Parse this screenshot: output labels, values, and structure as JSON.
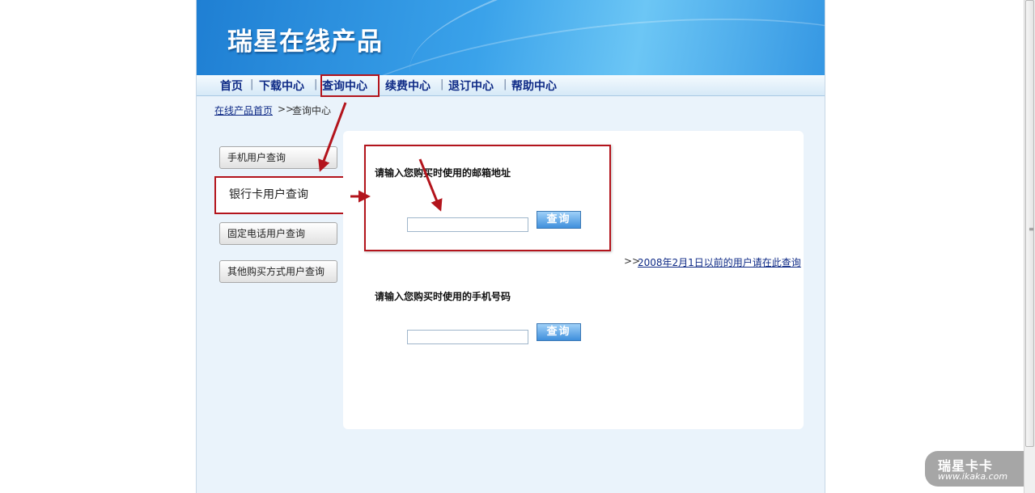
{
  "header": {
    "site_title": "瑞星在线产品"
  },
  "nav": {
    "items": [
      {
        "label": "首页"
      },
      {
        "label": "下载中心"
      },
      {
        "label": "查询中心"
      },
      {
        "label": "续费中心"
      },
      {
        "label": "退订中心"
      },
      {
        "label": "帮助中心"
      }
    ],
    "separator": "|",
    "active_index": 2
  },
  "breadcrumb": {
    "home_label": "在线产品首页",
    "separator": ">>",
    "current": "查询中心"
  },
  "sidebar": {
    "items": [
      {
        "label": "手机用户查询"
      },
      {
        "label": "银行卡用户查询"
      },
      {
        "label": "固定电话用户查询"
      },
      {
        "label": "其他购买方式用户查询"
      }
    ],
    "active_index": 1
  },
  "email_query": {
    "label": "请输入您购买时使用的邮箱地址",
    "value": "",
    "button_label": "查询"
  },
  "old_users": {
    "arrow": ">>",
    "link_label": "2008年2月1日以前的用户请在此查询"
  },
  "phone_query": {
    "label": "请输入您购买时使用的手机号码",
    "value": "",
    "button_label": "查询"
  },
  "watermark": {
    "title": "瑞星卡卡",
    "url": "www.ikaka.com"
  },
  "colors": {
    "annotation_red": "#b3141c",
    "nav_text": "#0e2a86",
    "page_bg": "#eaf3fb"
  }
}
